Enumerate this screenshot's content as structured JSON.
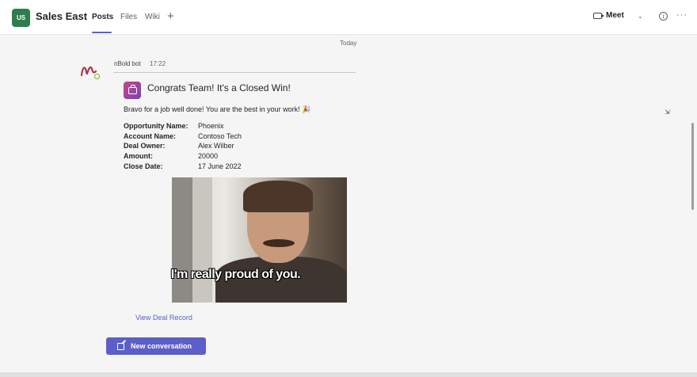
{
  "header": {
    "team_initials": "US",
    "team_name": "Sales East",
    "tabs": [
      {
        "label": "Posts",
        "active": true
      },
      {
        "label": "Files",
        "active": false
      },
      {
        "label": "Wiki",
        "active": false
      }
    ],
    "add_tab_glyph": "+",
    "meet_label": "Meet",
    "meet_dropdown_glyph": "⌄",
    "info_glyph": "i",
    "more_glyph": "···"
  },
  "feed": {
    "date_divider": "Today",
    "message": {
      "sender": "nBold bot",
      "time": "17:22",
      "card": {
        "title": "Congrats Team! It's a Closed Win!",
        "subtitle": "Bravo for a job well done! You are the best in your work! 🎉",
        "facts": [
          {
            "label": "Opportunity Name:",
            "value": "Phoenix"
          },
          {
            "label": "Account Name:",
            "value": "Contoso Tech"
          },
          {
            "label": "Deal Owner:",
            "value": "Alex Wilber"
          },
          {
            "label": "Amount:",
            "value": "20000"
          },
          {
            "label": "Close Date:",
            "value": "17 June 2022"
          }
        ],
        "gif_caption": "I'm really proud of you.",
        "action_label": "View Deal Record"
      }
    },
    "new_conversation_label": "New conversation"
  },
  "colors": {
    "accent": "#5b5fc7",
    "team_avatar": "#2e7d4f",
    "presence": "#6bb700"
  },
  "icons": [
    "video-camera-icon",
    "info-icon",
    "more-options-icon",
    "compose-icon",
    "briefcase-icon",
    "nbold-logo-icon"
  ]
}
